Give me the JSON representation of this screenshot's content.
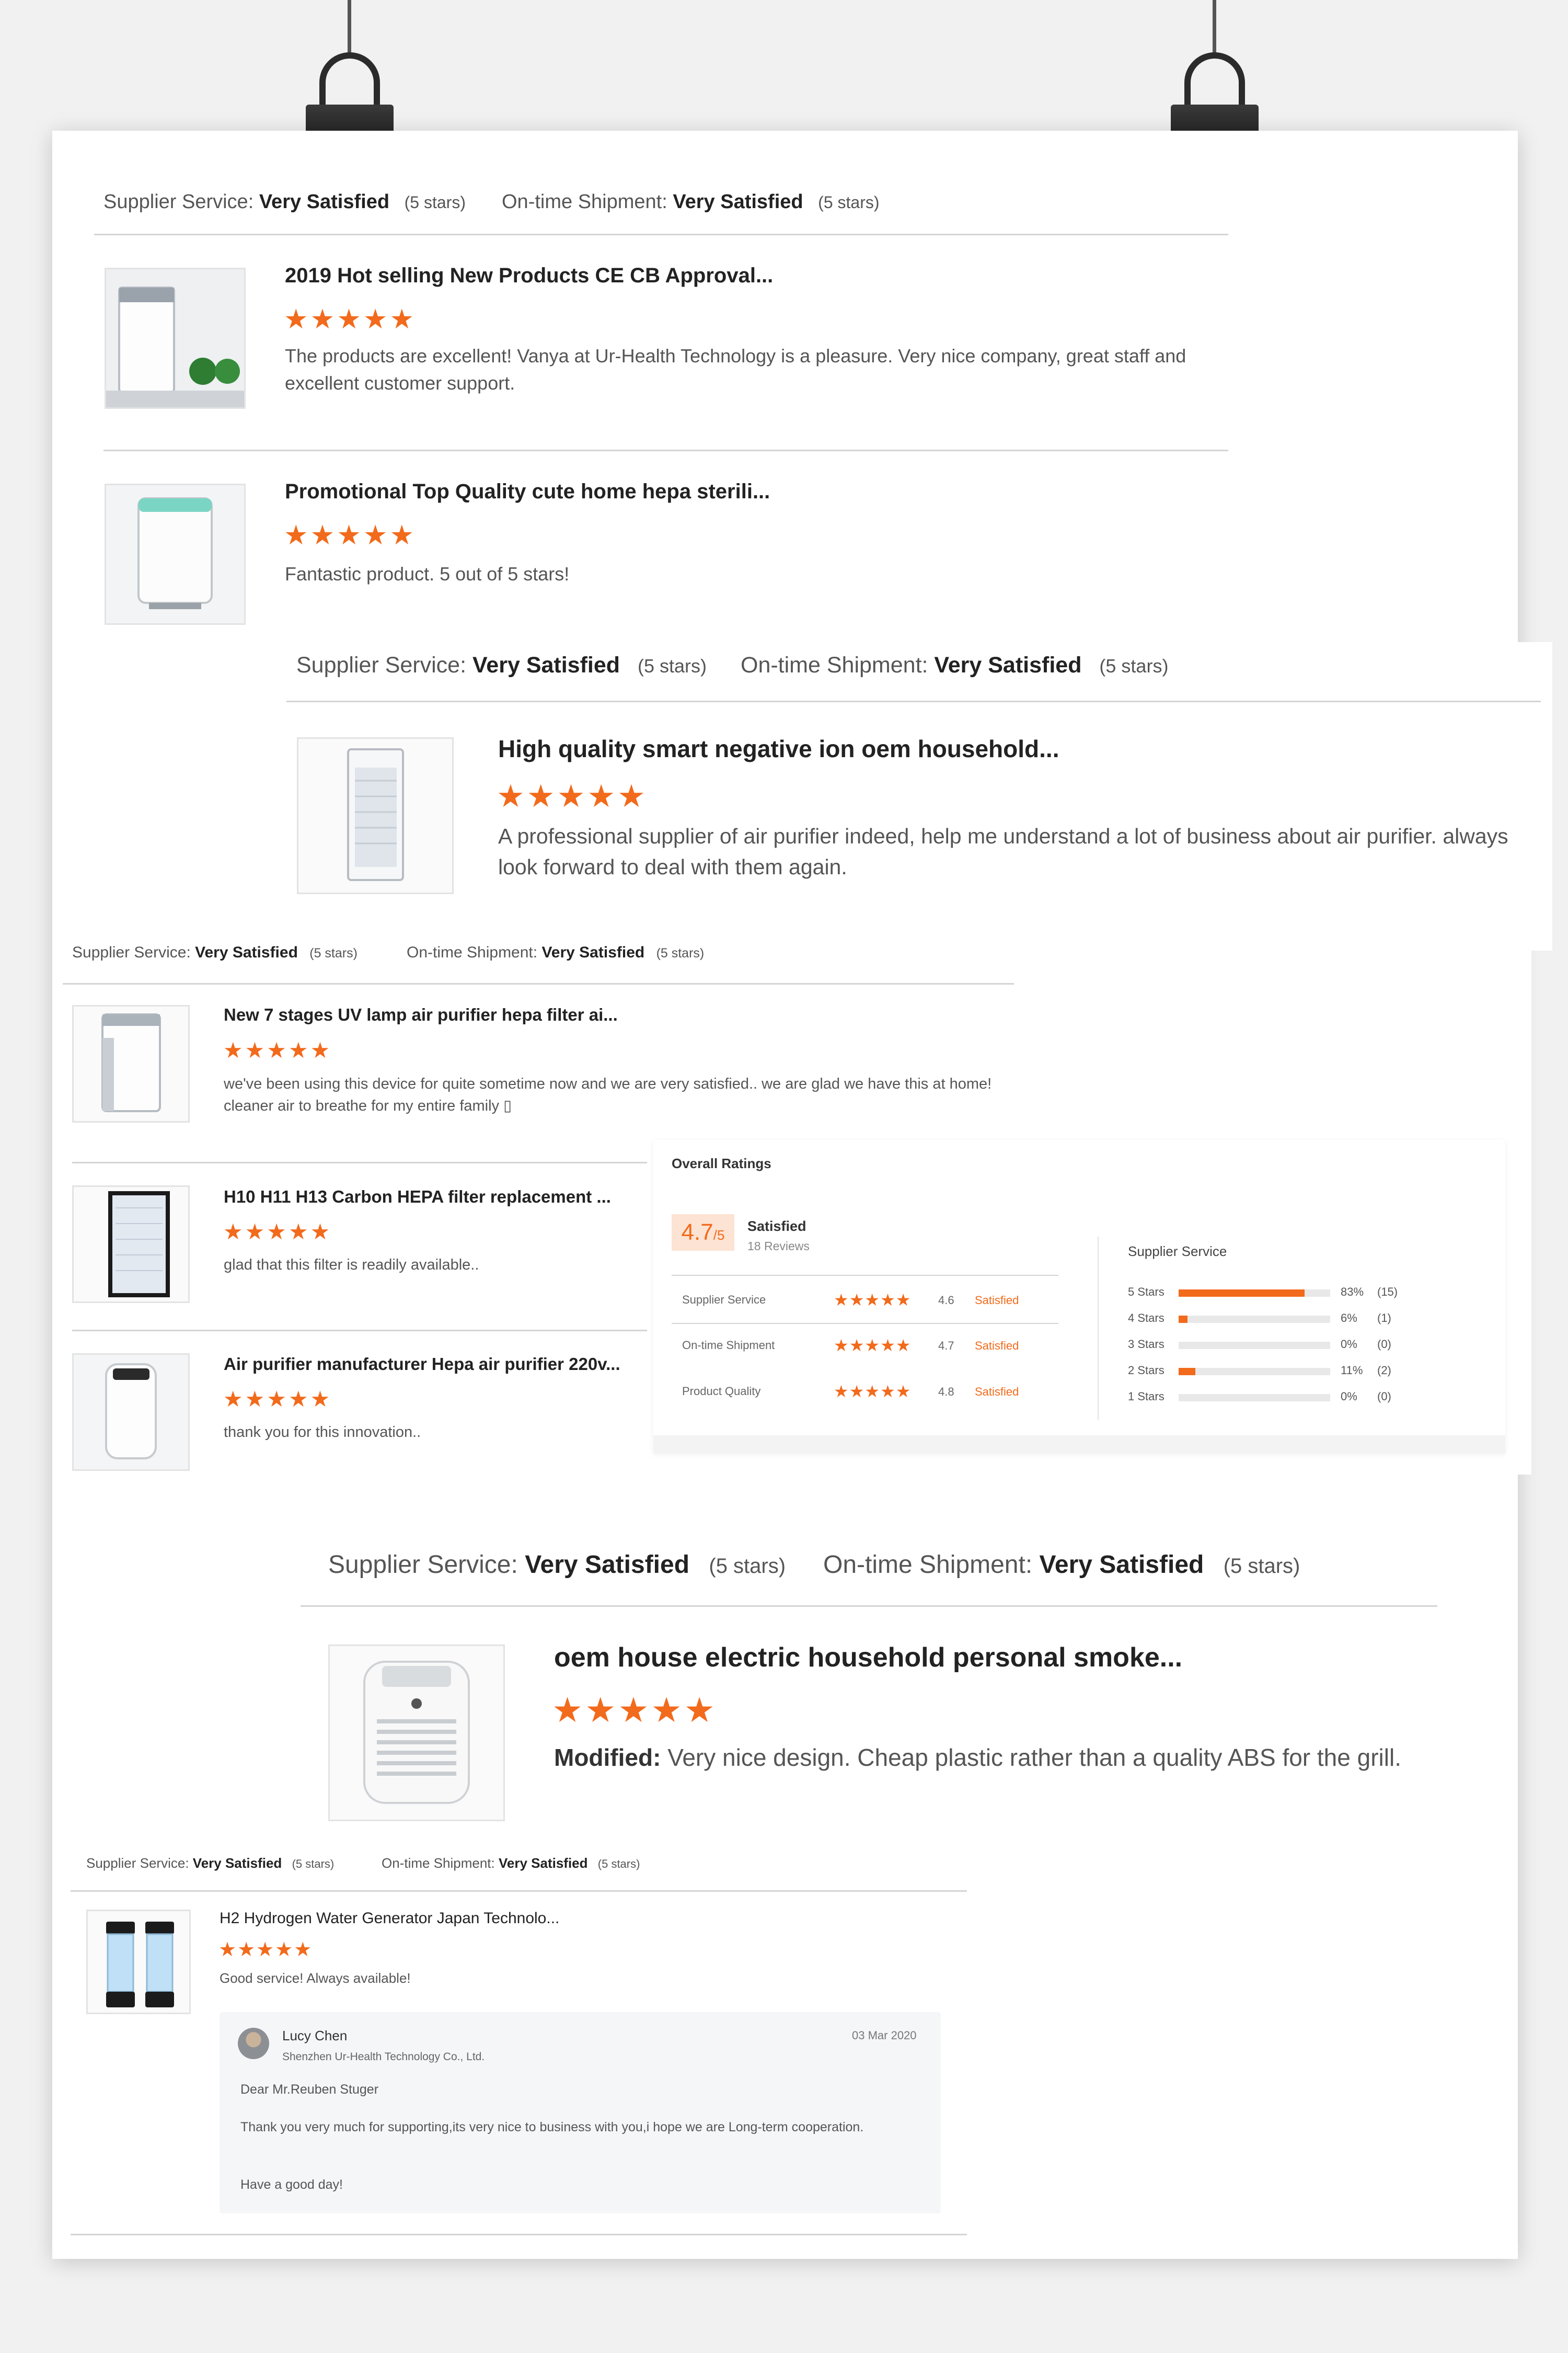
{
  "reviews": [
    {
      "supplier_service_label": "Supplier Service:",
      "supplier_service_value": "Very Satisfied",
      "supplier_service_stars": "(5 stars)",
      "shipment_label": "On-time Shipment:",
      "shipment_value": "Very Satisfied",
      "shipment_stars": "(5 stars)",
      "items": [
        {
          "title": "2019 Hot selling New Products CE CB Approval...",
          "stars": "★★★★★",
          "text": "The products are excellent! Vanya at Ur-Health Technology is a pleasure. Very nice company, great staff and excellent customer support."
        },
        {
          "title": "Promotional Top Quality cute home hepa sterili...",
          "stars": "★★★★★",
          "text": "Fantastic product. 5 out of 5 stars!"
        }
      ]
    },
    {
      "supplier_service_label": "Supplier Service:",
      "supplier_service_value": "Very Satisfied",
      "supplier_service_stars": "(5 stars)",
      "shipment_label": "On-time Shipment:",
      "shipment_value": "Very Satisfied",
      "shipment_stars": "(5 stars)",
      "items": [
        {
          "title": "High quality smart negative ion oem household...",
          "stars": "★★★★★",
          "text": "A professional supplier of air purifier indeed, help me understand a lot of business about air purifier. always look forward to deal with them again."
        }
      ]
    },
    {
      "supplier_service_label": "Supplier Service:",
      "supplier_service_value": "Very Satisfied",
      "supplier_service_stars": "(5 stars)",
      "shipment_label": "On-time Shipment:",
      "shipment_value": "Very Satisfied",
      "shipment_stars": "(5 stars)",
      "items": [
        {
          "title": "New 7 stages UV lamp air purifier hepa filter ai...",
          "stars": "★★★★★",
          "text": "we've been using this device for quite sometime now and we are very satisfied.. we are glad we have this at home! cleaner air to breathe for my entire family ▯"
        },
        {
          "title": "H10 H11 H13 Carbon HEPA filter replacement ...",
          "stars": "★★★★★",
          "text": "glad that this filter is readily available.."
        },
        {
          "title": "Air purifier manufacturer Hepa air purifier 220v...",
          "stars": "★★★★★",
          "text": "thank you for this innovation.."
        }
      ]
    },
    {
      "supplier_service_label": "Supplier Service:",
      "supplier_service_value": "Very Satisfied",
      "supplier_service_stars": "(5 stars)",
      "shipment_label": "On-time Shipment:",
      "shipment_value": "Very Satisfied",
      "shipment_stars": "(5 stars)",
      "items": [
        {
          "title": "oem house electric household personal smoke...",
          "stars": "★★★★★",
          "modified_label": "Modified:",
          "text": "Very nice design. Cheap plastic rather than a quality ABS for the grill."
        }
      ]
    },
    {
      "supplier_service_label": "Supplier Service:",
      "supplier_service_value": "Very Satisfied",
      "supplier_service_stars": "(5 stars)",
      "shipment_label": "On-time Shipment:",
      "shipment_value": "Very Satisfied",
      "shipment_stars": "(5 stars)",
      "items": [
        {
          "title": "H2 Hydrogen Water Generator Japan Technolo...",
          "stars": "★★★★★",
          "text": "Good service! Always available!"
        }
      ],
      "reply": {
        "name": "Lucy Chen",
        "company": "Shenzhen Ur-Health Technology Co., Ltd.",
        "date": "03 Mar 2020",
        "greeting": "Dear Mr.Reuben Stuger",
        "body": "Thank you very much for supporting,its very nice to business with you,i hope we are Long-term cooperation.",
        "closing": "Have a good day!"
      }
    }
  ],
  "overall": {
    "title": "Overall Ratings",
    "score": "4.7",
    "score_suffix": "/5",
    "status": "Satisfied",
    "reviews_count": "18 Reviews",
    "categories": [
      {
        "name": "Supplier Service",
        "stars": "★★★★★",
        "score": "4.6",
        "label": "Satisfied"
      },
      {
        "name": "On-time Shipment",
        "stars": "★★★★★",
        "score": "4.7",
        "label": "Satisfied"
      },
      {
        "name": "Product Quality",
        "stars": "★★★★★",
        "score": "4.8",
        "label": "Satisfied"
      }
    ],
    "breakdown_title": "Supplier Service",
    "breakdown": [
      {
        "label": "5 Stars",
        "percent_text": "83%",
        "count": "(15)",
        "fraction": 0.83
      },
      {
        "label": "4 Stars",
        "percent_text": "6%",
        "count": "(1)",
        "fraction": 0.06
      },
      {
        "label": "3 Stars",
        "percent_text": "0%",
        "count": "(0)",
        "fraction": 0.0
      },
      {
        "label": "2 Stars",
        "percent_text": "11%",
        "count": "(2)",
        "fraction": 0.11
      },
      {
        "label": "1 Stars",
        "percent_text": "0%",
        "count": "(0)",
        "fraction": 0.0
      }
    ]
  },
  "colors": {
    "accent": "#f26a1b",
    "score_bg": "#fde3d3"
  }
}
